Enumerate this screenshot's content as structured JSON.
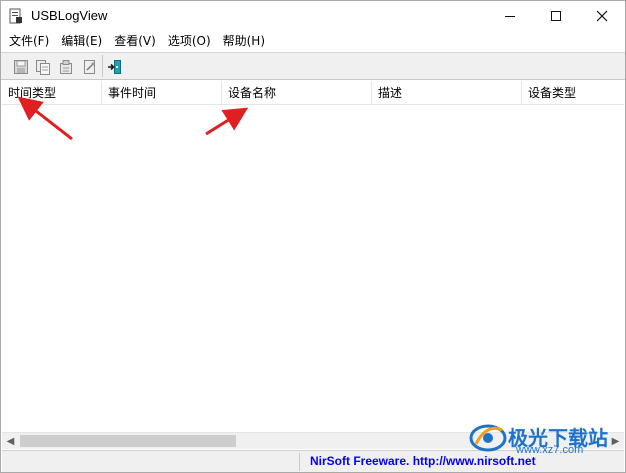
{
  "window": {
    "title": "USBLogView"
  },
  "menubar": {
    "items": [
      "文件(F)",
      "编辑(E)",
      "查看(V)",
      "选项(O)",
      "帮助(H)"
    ]
  },
  "toolbar": {
    "buttons": [
      "save-icon",
      "copy-icon",
      "properties-icon",
      "refresh-icon",
      "exit-icon"
    ]
  },
  "listview": {
    "columns": [
      "时间类型",
      "事件时间",
      "设备名称",
      "描述",
      "设备类型"
    ],
    "rows": []
  },
  "statusbar": {
    "link_text": "NirSoft Freeware.  http://www.nirsoft.net"
  },
  "watermark": {
    "brand": "极光下载站",
    "url": "www.xz7.com"
  },
  "colors": {
    "annotation_arrow": "#e02020",
    "link": "#0000ff",
    "watermark": "#1e73c8"
  }
}
